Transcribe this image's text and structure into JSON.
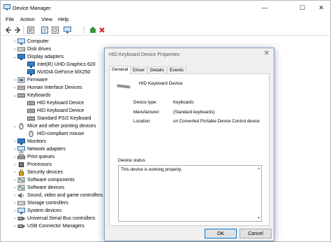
{
  "window": {
    "title": "Device Manager",
    "controls": {
      "minimize": "—",
      "maximize": "☐",
      "close": "✕"
    }
  },
  "menu": [
    "File",
    "Action",
    "View",
    "Help"
  ],
  "toolbar": [
    "back-icon",
    "forward-icon",
    "properties-icon",
    "help-icon",
    "scan-icon",
    "monitor-icon",
    "update-driver-icon",
    "uninstall-icon"
  ],
  "tree": [
    {
      "label": "Computer",
      "expanded": false,
      "icon": "computer-icon"
    },
    {
      "label": "Disk drives",
      "expanded": false,
      "icon": "disk-icon"
    },
    {
      "label": "Display adapters",
      "expanded": true,
      "icon": "display-icon"
    },
    {
      "label": "Intel(R) UHD Graphics 620",
      "child": true,
      "icon": "display-icon"
    },
    {
      "label": "NVIDIA GeForce MX250",
      "child": true,
      "icon": "display-icon"
    },
    {
      "label": "Firmware",
      "expanded": false,
      "icon": "firmware-icon"
    },
    {
      "label": "Human Interface Devices",
      "expanded": false,
      "icon": "hid-icon"
    },
    {
      "label": "Keyboards",
      "expanded": true,
      "icon": "keyboard-icon"
    },
    {
      "label": "HID Keyboard Device",
      "child": true,
      "icon": "keyboard-icon"
    },
    {
      "label": "HID Keyboard Device",
      "child": true,
      "icon": "keyboard-icon"
    },
    {
      "label": "Standard PS/2 Keyboard",
      "child": true,
      "icon": "keyboard-icon"
    },
    {
      "label": "Mice and other pointing devices",
      "expanded": true,
      "icon": "mouse-icon"
    },
    {
      "label": "HID-compliant mouse",
      "child": true,
      "icon": "mouse-icon"
    },
    {
      "label": "Monitors",
      "expanded": false,
      "icon": "monitor-icon"
    },
    {
      "label": "Network adapters",
      "expanded": false,
      "icon": "network-icon"
    },
    {
      "label": "Print queues",
      "expanded": false,
      "icon": "printer-icon"
    },
    {
      "label": "Processors",
      "expanded": false,
      "icon": "processor-icon"
    },
    {
      "label": "Security devices",
      "expanded": false,
      "icon": "security-icon"
    },
    {
      "label": "Software components",
      "expanded": false,
      "icon": "component-icon"
    },
    {
      "label": "Software devices",
      "expanded": false,
      "icon": "component-icon"
    },
    {
      "label": "Sound, video and game controllers",
      "expanded": false,
      "icon": "sound-icon"
    },
    {
      "label": "Storage controllers",
      "expanded": false,
      "icon": "storage-icon"
    },
    {
      "label": "System devices",
      "expanded": false,
      "icon": "system-icon"
    },
    {
      "label": "Universal Serial Bus controllers",
      "expanded": false,
      "icon": "usb-icon"
    },
    {
      "label": "USB Connector Managers",
      "expanded": false,
      "icon": "usb-icon"
    }
  ],
  "dialog": {
    "title": "HID Keyboard Device Properties",
    "close": "✕",
    "tabs": [
      "General",
      "Driver",
      "Details",
      "Events"
    ],
    "active_tab": "General",
    "device_name": "HID Keyboard Device",
    "props": [
      {
        "label": "Device type:",
        "value": "Keyboards"
      },
      {
        "label": "Manufacturer:",
        "value": "(Standard keyboards)"
      },
      {
        "label": "Location:",
        "value": "on Converted Portable Device Control device"
      }
    ],
    "status_title": "Device status",
    "status_text": "This device is working properly.",
    "ok": "OK",
    "cancel": "Cancel"
  },
  "colors": {
    "accent": "#0078d7",
    "uninstall": "#cc1f1f",
    "folder": "#e8c25a"
  }
}
